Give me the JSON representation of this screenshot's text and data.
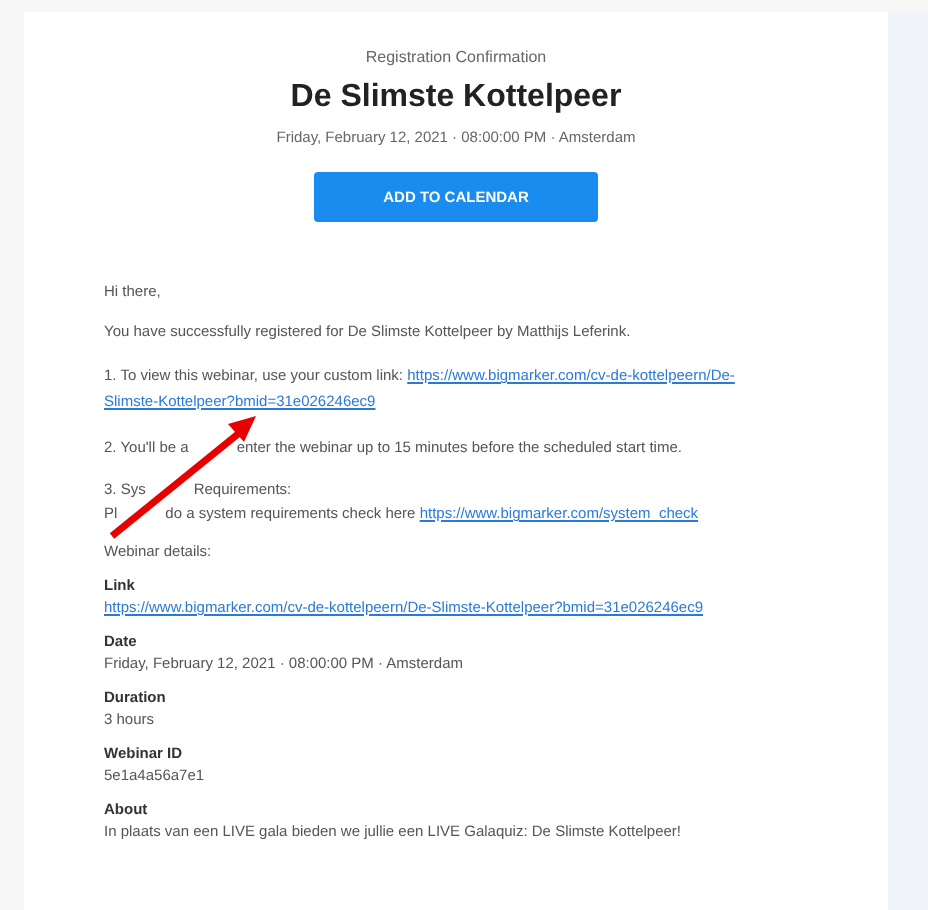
{
  "header": {
    "eyebrow": "Registration Confirmation",
    "title": "De Slimste Kottelpeer",
    "datetime": "Friday, February 12, 2021 · 08:00:00 PM · Amsterdam",
    "button": "ADD TO CALENDAR"
  },
  "greeting": "Hi there,",
  "intro": "You have successfully registered for De Slimste Kottelpeer by Matthijs Leferink.",
  "steps": [
    {
      "text_parts": [
        "1. To view this webinar, use your custom link:"
      ],
      "link_parts": [
        "https://www.bigmarker.com/cv-de-kottelpeern/De-",
        "Slimste-Kottelpeer?bmid=31e026246ec9"
      ]
    },
    {
      "text_parts": [
        "2. You'll be a",
        "enter the webinar up to 15 minutes before the scheduled start time."
      ]
    },
    {
      "heading_parts": [
        "3. Sys",
        "Requirements:"
      ],
      "text_parts": [
        "Pl",
        "do a system requirements check here"
      ],
      "link_parts": [
        "https://www.bigmarker.com/system_check"
      ]
    }
  ],
  "details_heading": "Webinar details:",
  "details": [
    {
      "label": "Link",
      "value": "https://www.bigmarker.com/cv-de-kottelpeern/De-Slimste-Kottelpeer?bmid=31e026246ec9",
      "kind": "link"
    },
    {
      "label": "Date",
      "value": "Friday, February 12, 2021 · 08:00:00 PM · Amsterdam",
      "kind": "text"
    },
    {
      "label": "Duration",
      "value": "3 hours",
      "kind": "text"
    },
    {
      "label": "Webinar ID",
      "value": "5e1a4a56a7e1",
      "kind": "text"
    },
    {
      "label": "About",
      "value": "In plaats van een LIVE gala bieden we jullie een LIVE Galaquiz: De Slimste Kottelpeer!",
      "kind": "text"
    }
  ]
}
